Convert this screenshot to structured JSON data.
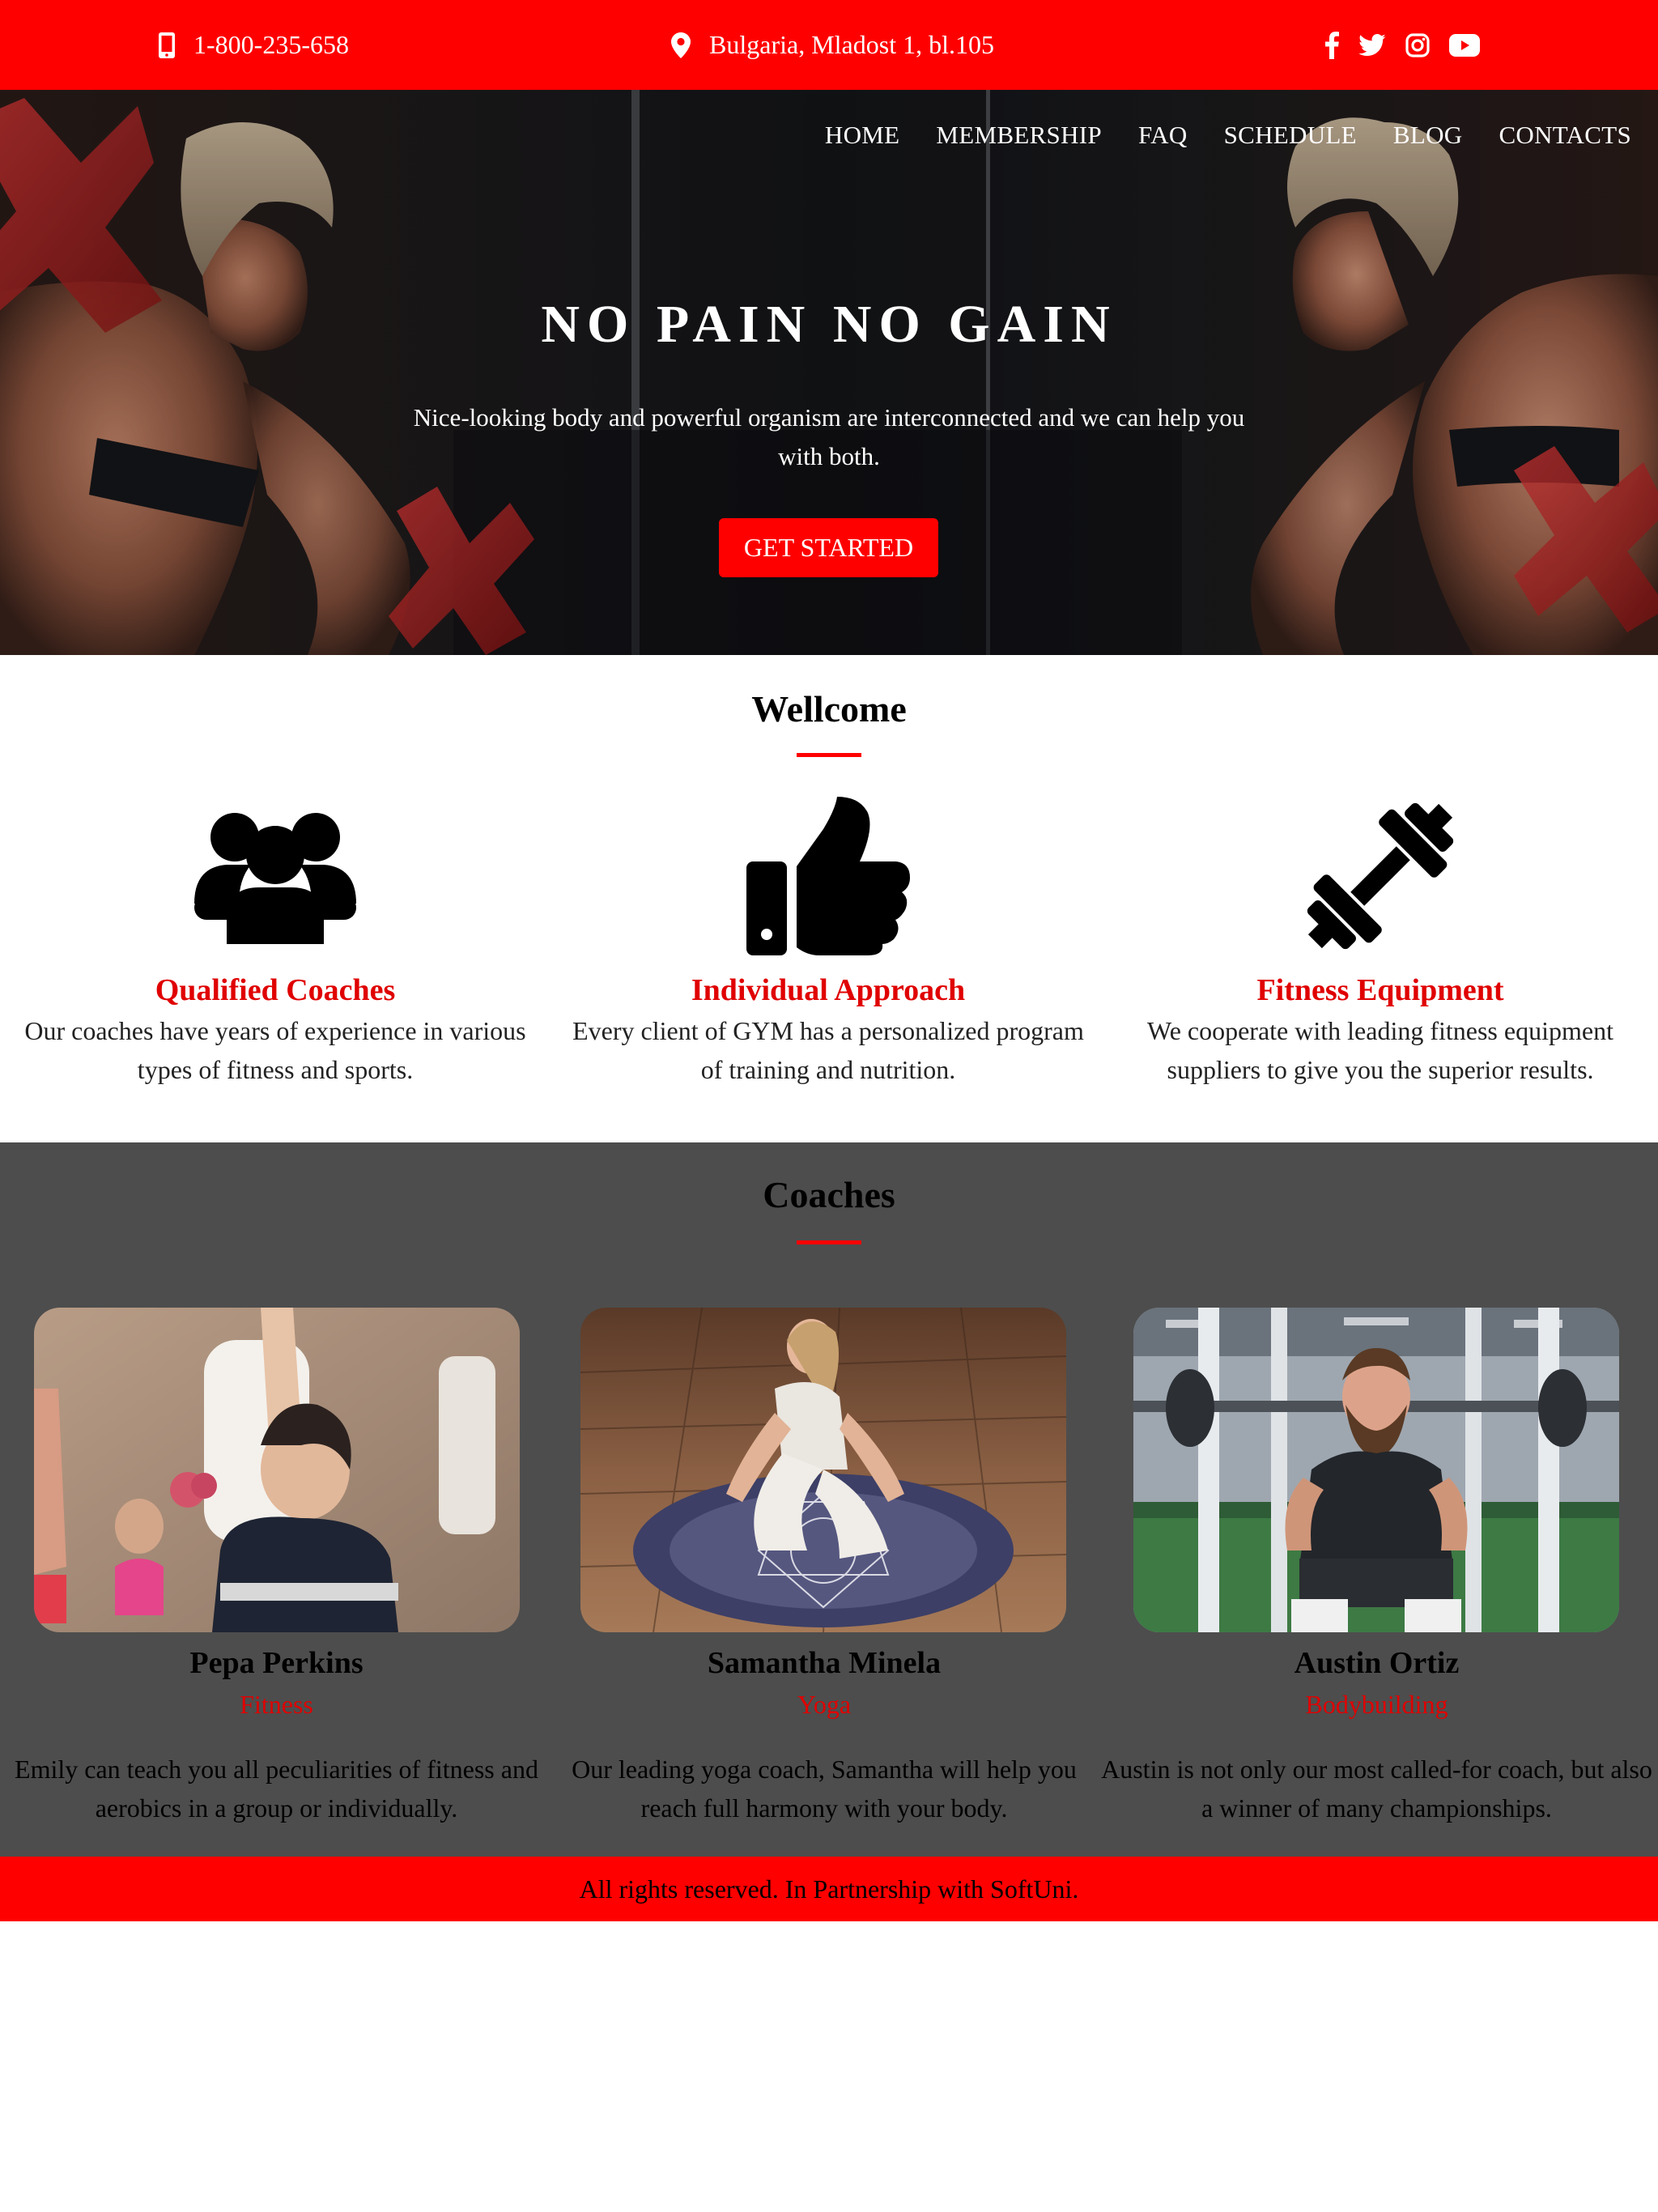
{
  "topbar": {
    "phone": "1-800-235-658",
    "address": "Bulgaria, Mladost 1, bl.105",
    "social": [
      "facebook-icon",
      "twitter-icon",
      "instagram-icon",
      "youtube-icon"
    ]
  },
  "nav": {
    "items": [
      "HOME",
      "MEMBERSHIP",
      "FAQ",
      "SCHEDULE",
      "BLOG",
      "CONTACTS"
    ]
  },
  "hero": {
    "title": "NO PAIN NO GAIN",
    "text": "Nice-looking body and powerful organism are interconnected and we can help you with both.",
    "cta": "GET STARTED"
  },
  "welcome": {
    "title": "Wellcome",
    "features": [
      {
        "icon": "users-icon",
        "title": "Qualified Coaches",
        "text": "Our coaches have years of experience in various types of fitness and sports."
      },
      {
        "icon": "thumbs-up-icon",
        "title": "Individual Approach",
        "text": "Every client of GYM has a personalized program of training and nutrition."
      },
      {
        "icon": "dumbbell-icon",
        "title": "Fitness Equipment",
        "text": "We cooperate with leading fitness equipment suppliers to give you the superior results."
      }
    ]
  },
  "coaches": {
    "title": "Coaches",
    "items": [
      {
        "name": "Pepa Perkins",
        "role": "Fitness",
        "bio": "Emily can teach you all peculiarities of fitness and aerobics in a group or individually."
      },
      {
        "name": "Samantha Minela",
        "role": "Yoga",
        "bio": "Our leading yoga coach, Samantha will help you reach full harmony with your body."
      },
      {
        "name": "Austin Ortiz",
        "role": "Bodybuilding",
        "bio": "Austin is not only our most called-for coach, but also a winner of many championships."
      }
    ]
  },
  "footer": {
    "text": "All rights reserved. In Partnership with SoftUni."
  },
  "colors": {
    "accent": "#ff0000",
    "coaches_bg": "#4d4d4d",
    "feature_title": "#e00000"
  }
}
